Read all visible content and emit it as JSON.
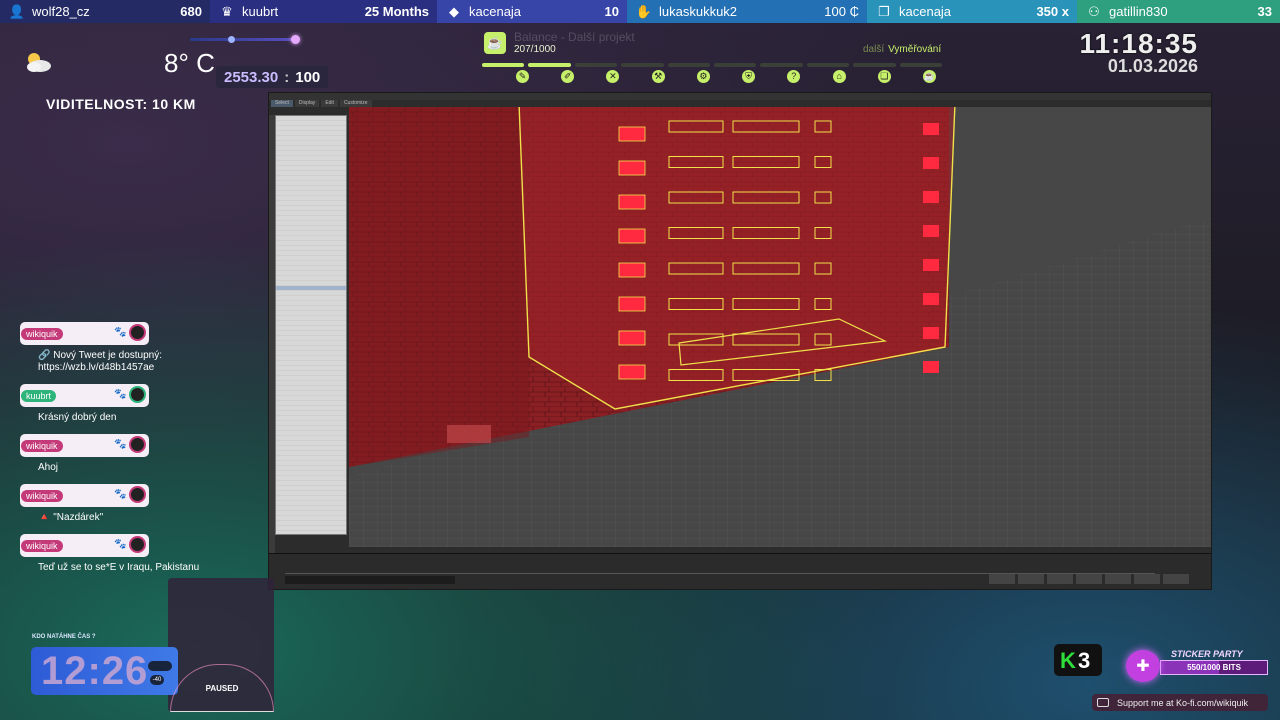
{
  "topbar": {
    "segments": [
      {
        "icon": "user-plus-icon",
        "glyph": "👤",
        "name": "wolf28_cz",
        "value": "680"
      },
      {
        "icon": "crown-icon",
        "glyph": "♛",
        "name": "kuubrt",
        "value": "25 Months"
      },
      {
        "icon": "diamond-icon",
        "glyph": "◆",
        "name": "kacenaja",
        "value": "10"
      },
      {
        "icon": "hand-icon",
        "glyph": "✋",
        "name": "lukaskukkuk2",
        "value": "100 ₵"
      },
      {
        "icon": "gift-icon",
        "glyph": "❐",
        "name": "kacenaja",
        "value": "350 x"
      },
      {
        "icon": "handshake-icon",
        "glyph": "⚇",
        "name": "gatillin830",
        "value": "33"
      }
    ]
  },
  "weather": {
    "icon": "partly-cloudy-icon",
    "temperature": "8° C",
    "visibility": "VIDITELNOST:  10 KM"
  },
  "counter": {
    "value": "2553.30",
    "separator": ":",
    "max": "100"
  },
  "goal": {
    "title": "Balance - Další projekt",
    "progress_text": "207/1000",
    "progress_fraction": 0.207,
    "next_prefix": "další",
    "next_label": "Vyměřování",
    "milestone_icons": [
      "pencil-icon",
      "brush-icon",
      "tools-icon",
      "hammer-icon",
      "wrench-icon",
      "shield-icon",
      "question-icon",
      "home-icon",
      "bookmark-icon",
      "coffee-icon"
    ]
  },
  "clock": {
    "time": "11:18:35",
    "date": "01.03.2026"
  },
  "app": {
    "tabs": [
      "Select",
      "Display",
      "Edit",
      "Customize"
    ]
  },
  "chat": {
    "messages": [
      {
        "user": "wikiquik",
        "color": "#c43a78",
        "text": "🔗 Nový Tweet je dostupný: https://wzb.lv/d48b1457ae"
      },
      {
        "user": "kuubrt",
        "color": "#2eb37a",
        "text": "Krásný dobrý den"
      },
      {
        "user": "wikiquik",
        "color": "#c43a78",
        "text": "Ahoj"
      },
      {
        "user": "wikiquik",
        "color": "#c43a78",
        "text": "🔺 \"Nazdárek\""
      },
      {
        "user": "wikiquik",
        "color": "#c43a78",
        "text": "Teď už se to se*E v Iraqu, Pakistanu"
      }
    ]
  },
  "timer": {
    "label": "KDO NATÁHNE ČAS ?",
    "value": "12:26",
    "chip_value": "-40"
  },
  "paused": {
    "label": "PAUSED"
  },
  "k3": {
    "k": "K",
    "n": "3"
  },
  "sticker": {
    "title": "STICKER PARTY",
    "count": "550/1000 BITS",
    "fraction": 0.55
  },
  "kofi": {
    "text": "Support me at Ko-fi.com/wikiquik"
  }
}
